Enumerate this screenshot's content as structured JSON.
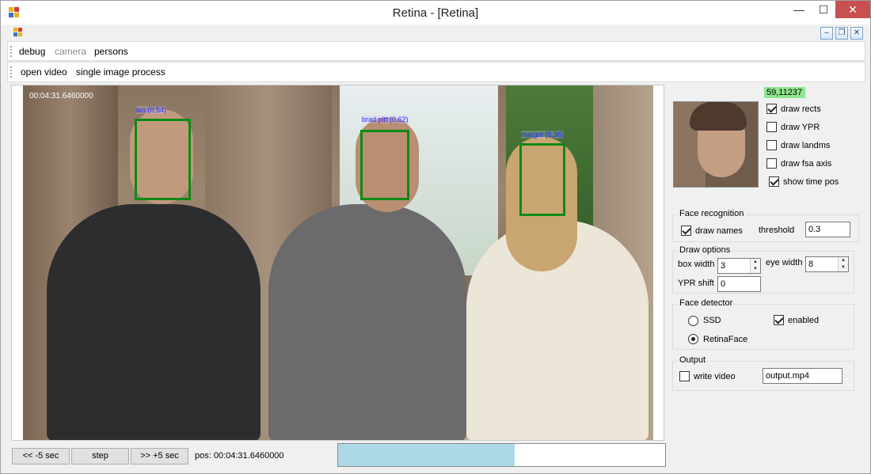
{
  "window": {
    "title": "Retina - [Retina]",
    "minimize": "—",
    "maximize": "☐",
    "close": "✕"
  },
  "mdi": {
    "minimize": "–",
    "restore": "❐",
    "close": "✕"
  },
  "menu": {
    "items": [
      {
        "label": "debug",
        "enabled": true
      },
      {
        "label": "camera",
        "enabled": false
      },
      {
        "label": "persons",
        "enabled": true
      }
    ]
  },
  "toolbar": {
    "items": [
      {
        "label": "open video"
      },
      {
        "label": "single image process"
      }
    ]
  },
  "video": {
    "timestamp": "00:04:31.6460000",
    "faces": [
      {
        "name": "leo (0,54)"
      },
      {
        "name": "brad pitt (0,62)"
      },
      {
        "name": "margot (0,36)"
      }
    ]
  },
  "side": {
    "fps": "59,11237",
    "fps_color": "#8fe68f",
    "checks": [
      {
        "label": "draw rects",
        "checked": true
      },
      {
        "label": "draw YPR",
        "checked": false
      },
      {
        "label": "draw landms",
        "checked": false
      },
      {
        "label": "draw fsa axis",
        "checked": false
      },
      {
        "label": "show time pos",
        "checked": true
      }
    ],
    "face_recognition": {
      "title": "Face recognition",
      "draw_names_label": "draw names",
      "draw_names": true,
      "threshold_label": "threshold",
      "threshold": "0.3"
    },
    "draw_options": {
      "title": "Draw options",
      "box_width_label": "box width",
      "box_width": "3",
      "eye_width_label": "eye width",
      "eye_width": "8",
      "ypr_shift_label": "YPR shift",
      "ypr_shift": "0"
    },
    "face_detector": {
      "title": "Face detector",
      "ssd_label": "SSD",
      "retina_label": "RetinaFace",
      "selected": "RetinaFace",
      "enabled_label": "enabled",
      "enabled": true
    },
    "output": {
      "title": "Output",
      "write_video_label": "write video",
      "write_video": false,
      "filename": "output.mp4"
    }
  },
  "bottom": {
    "back_label": "<< -5 sec",
    "step_label": "step",
    "fwd_label": ">> +5 sec",
    "pos_text": "pos: 00:04:31.6460000",
    "progress": 0.54,
    "progress_color": "#add8e6"
  }
}
